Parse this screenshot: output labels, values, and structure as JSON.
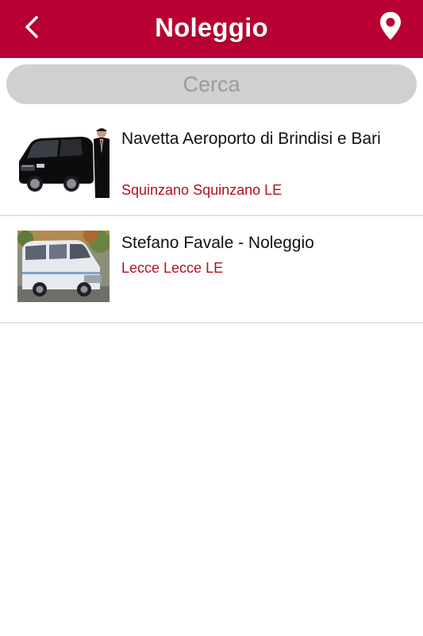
{
  "header": {
    "title": "Noleggio",
    "back_icon": "chevron-left-icon",
    "map_icon": "map-pin-icon",
    "color": "#b90034"
  },
  "search": {
    "placeholder": "Cerca",
    "value": ""
  },
  "listings": [
    {
      "title": "Navetta Aeroporto di Brindisi e Bari",
      "location": "Squinzano Squinzano LE",
      "image": "black-van-with-chauffeur-photo"
    },
    {
      "title": "Stefano Favale - Noleggio",
      "location": "Lecce Lecce LE",
      "image": "white-minibus-photo"
    }
  ],
  "colors": {
    "accent": "#b90034",
    "location_text": "#b3101e",
    "search_bg": "#d0d0d0"
  }
}
